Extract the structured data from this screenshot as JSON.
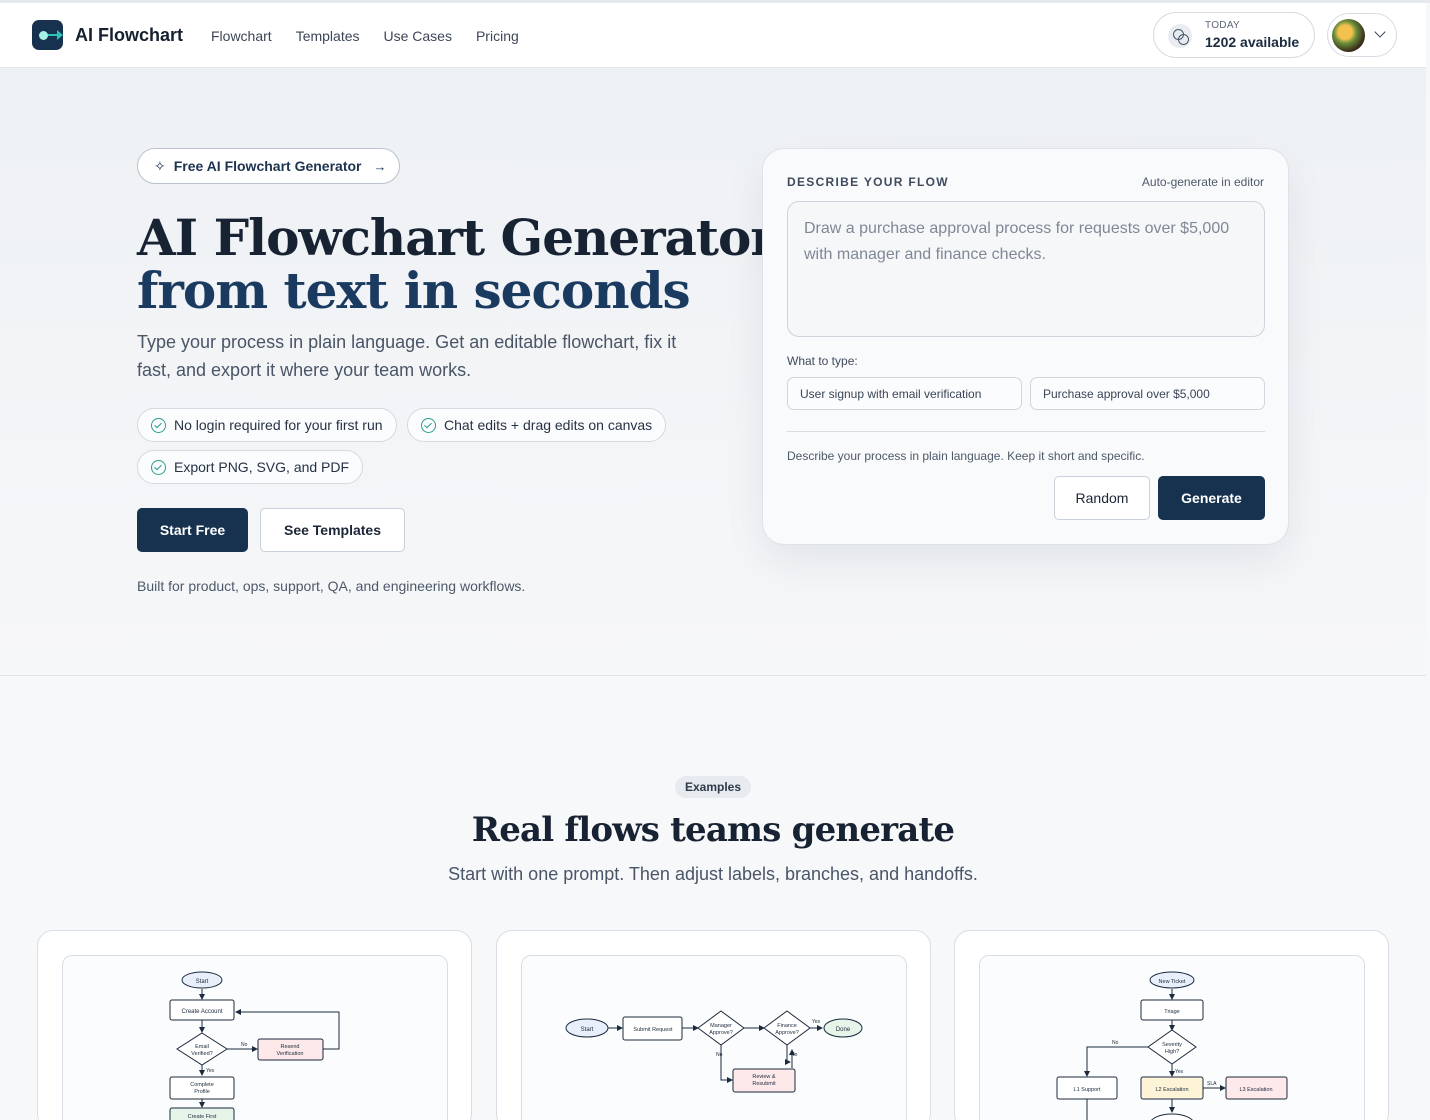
{
  "header": {
    "brand": "AI Flowchart",
    "nav": [
      "Flowchart",
      "Templates",
      "Use Cases",
      "Pricing"
    ],
    "credits_label": "TODAY",
    "credits_value": "1202 available"
  },
  "hero": {
    "pill": "Free AI Flowchart Generator",
    "title_line1": "AI Flowchart Generator",
    "title_line2": "from text in seconds",
    "subtitle": "Type your process in plain language. Get an editable flowchart, fix it fast, and export it where your team works.",
    "chips": [
      "No login required for your first run",
      "Chat edits + drag edits on canvas",
      "Export PNG, SVG, and PDF"
    ],
    "start_free": "Start Free",
    "see_templates": "See Templates",
    "built_for": "Built for product, ops, support, QA, and engineering workflows."
  },
  "form": {
    "title": "DESCRIBE YOUR FLOW",
    "auto_label": "Auto-generate in editor",
    "placeholder": "Draw a purchase approval process for requests over $5,000 with manager and finance checks.",
    "what_to_type": "What to type:",
    "suggestions": [
      "User signup with email verification",
      "Purchase approval over $5,000"
    ],
    "hint": "Describe your process in plain language. Keep it short and specific.",
    "random": "Random",
    "generate": "Generate"
  },
  "examples": {
    "badge": "Examples",
    "title": "Real flows teams generate",
    "subtitle": "Start with one prompt. Then adjust labels, branches, and handoffs.",
    "flow1": {
      "start": "Start",
      "create": "Create Account",
      "verified1": "Email",
      "verified2": "Verified?",
      "no": "No",
      "yes": "Yes",
      "resend1": "Resend",
      "resend2": "Verification",
      "complete1": "Complete",
      "complete2": "Profile",
      "final": "Create First"
    },
    "flow2": {
      "start": "Start",
      "submit": "Submit Request",
      "mgr1": "Manager",
      "mgr2": "Approve?",
      "fin1": "Finance",
      "fin2": "Approve?",
      "yes": "Yes",
      "no": "No",
      "done": "Done",
      "review1": "Review &",
      "review2": "Resubmit"
    },
    "flow3": {
      "ticket": "New Ticket",
      "triage": "Triage",
      "sev1": "Severity",
      "sev2": "High?",
      "no": "No",
      "yes": "Yes",
      "l1": "L1 Support",
      "l2": "L2 Escalation",
      "sla": "SLA",
      "l3": "L3 Escalation"
    }
  },
  "colors": {
    "primary": "#16324f",
    "accent": "#2a9d8f"
  }
}
